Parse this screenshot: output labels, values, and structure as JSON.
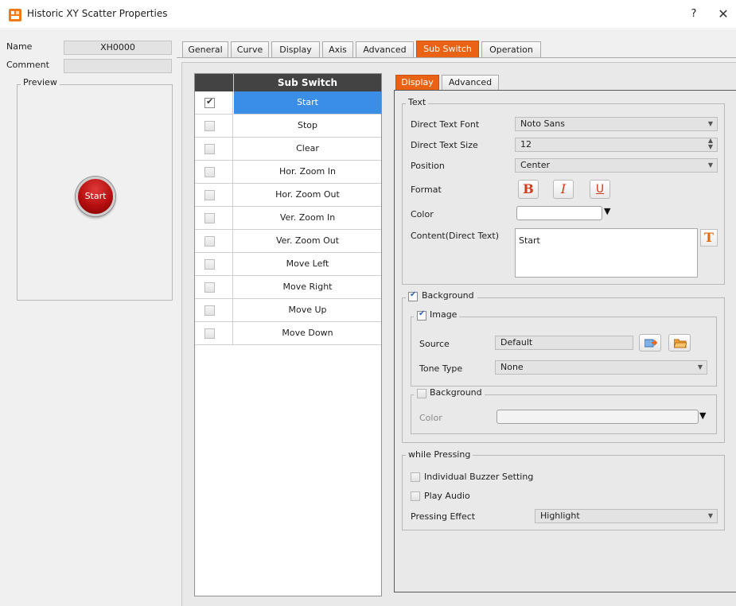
{
  "window": {
    "title": "Historic XY Scatter Properties",
    "help": "?",
    "close": "✕"
  },
  "left": {
    "name_label": "Name",
    "name_value": "XH0000",
    "comment_label": "Comment",
    "comment_value": "",
    "preview_label": "Preview",
    "preview_button": "Start"
  },
  "tabs": [
    "General",
    "Curve",
    "Display",
    "Axis",
    "Advanced",
    "Sub Switch",
    "Operation"
  ],
  "active_tab": "Sub Switch",
  "sub_switch": {
    "header": "Sub Switch",
    "rows": [
      {
        "label": "Start",
        "checked": true,
        "selected": true
      },
      {
        "label": "Stop",
        "checked": false,
        "selected": false
      },
      {
        "label": "Clear",
        "checked": false,
        "selected": false
      },
      {
        "label": "Hor. Zoom In",
        "checked": false,
        "selected": false
      },
      {
        "label": "Hor. Zoom Out",
        "checked": false,
        "selected": false
      },
      {
        "label": "Ver. Zoom In",
        "checked": false,
        "selected": false
      },
      {
        "label": "Ver. Zoom Out",
        "checked": false,
        "selected": false
      },
      {
        "label": "Move Left",
        "checked": false,
        "selected": false
      },
      {
        "label": "Move Right",
        "checked": false,
        "selected": false
      },
      {
        "label": "Move Up",
        "checked": false,
        "selected": false
      },
      {
        "label": "Move Down",
        "checked": false,
        "selected": false
      }
    ]
  },
  "sub_tabs": [
    "Display",
    "Advanced"
  ],
  "active_sub_tab": "Display",
  "text_group": {
    "legend": "Text",
    "font_label": "Direct Text Font",
    "font_value": "Noto Sans",
    "size_label": "Direct Text Size",
    "size_value": "12",
    "position_label": "Position",
    "position_value": "Center",
    "format_label": "Format",
    "bold": "B",
    "italic": "I",
    "underline": "U",
    "color_label": "Color",
    "content_label": "Content(Direct Text)",
    "content_value": "Start",
    "text_icon": "T"
  },
  "background_group": {
    "legend": "Background",
    "checked": true,
    "image_legend": "Image",
    "image_checked": true,
    "source_label": "Source",
    "source_value": "Default",
    "tone_label": "Tone Type",
    "tone_value": "None",
    "bg_legend": "Background",
    "bg_checked": false,
    "color_label": "Color"
  },
  "pressing_group": {
    "legend": "while Pressing",
    "buzzer_label": "Individual Buzzer Setting",
    "buzzer_checked": false,
    "audio_label": "Play Audio",
    "audio_checked": false,
    "effect_label": "Pressing Effect",
    "effect_value": "Highlight"
  },
  "colors": {
    "accent": "#ea6214",
    "selection": "#3a8ee6",
    "header_dark": "#434343",
    "preview_button": "#b50f0f"
  },
  "icons": {
    "app": "app-icon",
    "import": "image-import-icon",
    "folder": "folder-open-icon"
  }
}
